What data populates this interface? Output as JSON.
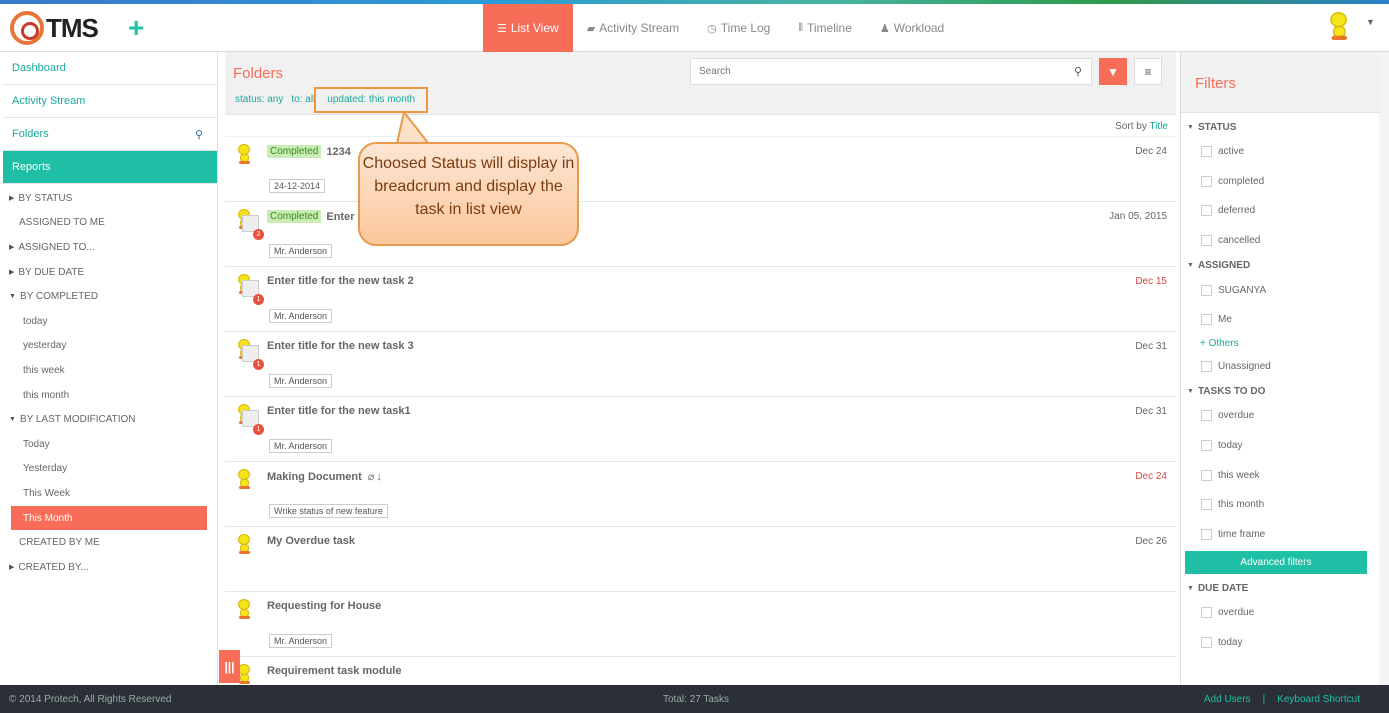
{
  "header": {
    "logo_text": "TMS",
    "plus": "+",
    "tabs": [
      {
        "label": "List View",
        "icon": "list-icon",
        "glyph": "☰"
      },
      {
        "label": "Activity Stream",
        "icon": "comment-icon",
        "glyph": "▰"
      },
      {
        "label": "Time Log",
        "icon": "clock-icon",
        "glyph": "◷"
      },
      {
        "label": "Timeline",
        "icon": "sliders-icon",
        "glyph": "⫴"
      },
      {
        "label": "Workload",
        "icon": "user-icon",
        "glyph": "♟"
      }
    ]
  },
  "sidebar": {
    "links": [
      "Dashboard",
      "Activity Stream",
      "Folders",
      "Reports"
    ],
    "tree": [
      {
        "label": "BY STATUS",
        "kind": "sec"
      },
      {
        "label": "ASSIGNED TO ME",
        "kind": "plain"
      },
      {
        "label": "ASSIGNED TO...",
        "kind": "sec"
      },
      {
        "label": "BY DUE DATE",
        "kind": "sec"
      },
      {
        "label": "BY COMPLETED",
        "kind": "sec",
        "open": true
      },
      {
        "label": "today",
        "kind": "sub"
      },
      {
        "label": "yesterday",
        "kind": "sub"
      },
      {
        "label": "this week",
        "kind": "sub"
      },
      {
        "label": "this month",
        "kind": "sub"
      },
      {
        "label": "BY LAST MODIFICATION",
        "kind": "sec",
        "open": true
      },
      {
        "label": "Today",
        "kind": "sub"
      },
      {
        "label": "Yesterday",
        "kind": "sub"
      },
      {
        "label": "This Week",
        "kind": "sub"
      },
      {
        "label": "This Month",
        "kind": "sub",
        "selected": true
      },
      {
        "label": "CREATED BY ME",
        "kind": "plain"
      },
      {
        "label": "CREATED BY...",
        "kind": "sec"
      }
    ]
  },
  "main": {
    "title": "Folders",
    "search_placeholder": "Search",
    "crumbs": [
      "status: any",
      "to: all",
      "updated: this month"
    ],
    "sort_prefix": "Sort by",
    "sort_field": "Title",
    "tasks": [
      {
        "status": "Completed",
        "title": "1234",
        "date": "Dec 24",
        "overdue": false,
        "tag": "24-12-2014",
        "badge": ""
      },
      {
        "status": "Completed",
        "title": "Enter t",
        "date": "Jan 05, 2015",
        "overdue": false,
        "tag": "Mr. Anderson",
        "badge": "2"
      },
      {
        "status": "",
        "title": "Enter title for the new task 2",
        "date": "Dec 15",
        "overdue": true,
        "tag": "Mr. Anderson",
        "badge": "1"
      },
      {
        "status": "",
        "title": "Enter title for the new task 3",
        "date": "Dec 31",
        "overdue": false,
        "tag": "Mr. Anderson",
        "badge": "1"
      },
      {
        "status": "",
        "title": "Enter title for the new task1",
        "date": "Dec 31",
        "overdue": false,
        "tag": "Mr. Anderson",
        "badge": "1"
      },
      {
        "status": "",
        "title": "Making Document",
        "date": "Dec 24",
        "overdue": true,
        "tag": "Wrike status of new feature",
        "badge": "",
        "attach": true
      },
      {
        "status": "",
        "title": "My Overdue task",
        "date": "Dec 26",
        "overdue": false,
        "tag": "",
        "badge": ""
      },
      {
        "status": "",
        "title": "Requesting for House",
        "date": "",
        "overdue": false,
        "tag": "Mr. Anderson",
        "badge": ""
      },
      {
        "status": "",
        "title": "Requirement task module",
        "date": "",
        "overdue": false,
        "tag": "",
        "badge": ""
      }
    ]
  },
  "callout": {
    "text": "Choosed Status will display in breadcrum and display the task in list view"
  },
  "filters": {
    "title": "Filters",
    "sections": [
      {
        "label": "STATUS",
        "items": [
          {
            "t": "opt",
            "label": "active"
          },
          {
            "t": "opt",
            "label": "completed"
          },
          {
            "t": "opt",
            "label": "deferred"
          },
          {
            "t": "opt",
            "label": "cancelled"
          }
        ]
      },
      {
        "label": "ASSIGNED",
        "items": [
          {
            "t": "opt",
            "label": "SUGANYA"
          },
          {
            "t": "opt",
            "label": "Me"
          },
          {
            "t": "link",
            "label": "+ Others"
          },
          {
            "t": "opt",
            "label": "Unassigned"
          }
        ]
      },
      {
        "label": "TASKS TO DO",
        "items": [
          {
            "t": "opt",
            "label": "overdue"
          },
          {
            "t": "opt",
            "label": "today"
          },
          {
            "t": "opt",
            "label": "this week"
          },
          {
            "t": "opt",
            "label": "this month"
          },
          {
            "t": "opt",
            "label": "time frame"
          },
          {
            "t": "btn",
            "label": "Advanced filters"
          }
        ]
      },
      {
        "label": "DUE DATE",
        "items": [
          {
            "t": "opt",
            "label": "overdue"
          },
          {
            "t": "opt",
            "label": "today"
          }
        ]
      }
    ]
  },
  "footer": {
    "copyright": "© 2014 Protech, All Rights Reserved",
    "total": "Total: 27 Tasks",
    "add_users": "Add Users",
    "separator": "|",
    "shortcut": "Keyboard Shortcut"
  },
  "colors": {
    "accent": "#f76d57",
    "teal": "#1fbfa6",
    "footer": "#2b3036"
  }
}
